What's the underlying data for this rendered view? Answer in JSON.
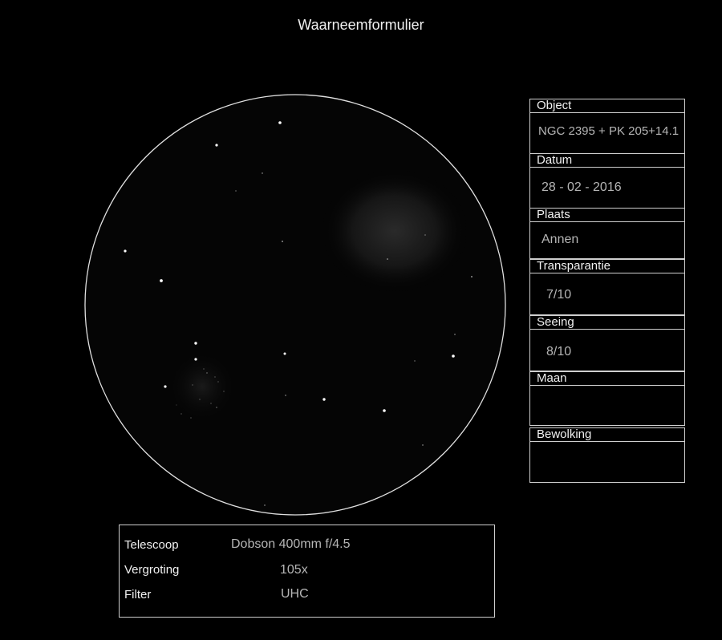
{
  "title": "Waarneemformulier",
  "fields": [
    {
      "label": "Object",
      "value": "NGC 2395 + PK 205+14.1"
    },
    {
      "label": "Datum",
      "value": "28 - 02 - 2016"
    },
    {
      "label": "Plaats",
      "value": "Annen"
    },
    {
      "label": "Transparantie",
      "value": "7/10"
    },
    {
      "label": "Seeing",
      "value": "8/10"
    },
    {
      "label": "Maan",
      "value": ""
    },
    {
      "label": "Bewolking",
      "value": ""
    }
  ],
  "equipment": [
    {
      "label": "Telescoop",
      "value": "Dobson 400mm f/4.5"
    },
    {
      "label": "Vergroting",
      "value": "105x"
    },
    {
      "label": "Filter",
      "value": "UHC"
    }
  ]
}
